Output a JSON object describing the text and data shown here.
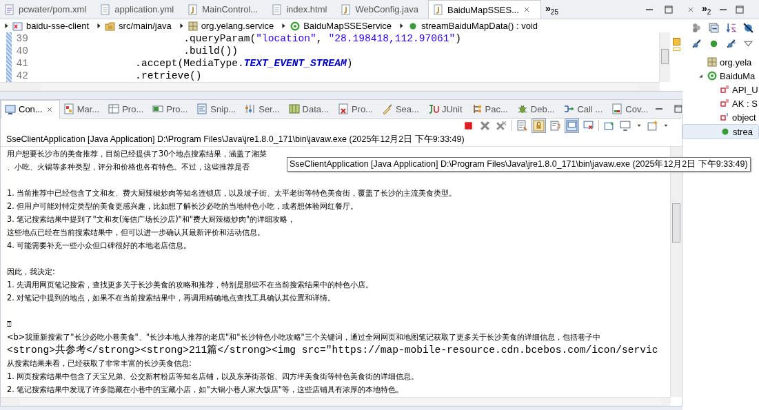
{
  "editor_tabs": [
    {
      "label": "pcwater/pom.xml",
      "selected": false
    },
    {
      "label": "application.yml",
      "selected": false
    },
    {
      "label": "MainControl...",
      "selected": false
    },
    {
      "label": "index.html",
      "selected": false
    },
    {
      "label": "WebConfig.java",
      "selected": false
    },
    {
      "label": "BaiduMapSSES...",
      "selected": true
    }
  ],
  "editor_overflow": {
    "glyph": "»",
    "count": "25"
  },
  "breadcrumb": [
    {
      "label": "baidu-sse-client"
    },
    {
      "label": "src/main/java"
    },
    {
      "label": "org.yelang.service"
    },
    {
      "label": "BaiduMapSSEService"
    },
    {
      "label": "streamBaiduMapData() : void"
    }
  ],
  "code_lines": [
    {
      "number": "39",
      "segments": [
        {
          "text": "                        .queryParam(",
          "kind": "plain"
        },
        {
          "text": "\"location\"",
          "kind": "string"
        },
        {
          "text": ", ",
          "kind": "plain"
        },
        {
          "text": "\"28.198418,112.97061\"",
          "kind": "string"
        },
        {
          "text": ")",
          "kind": "plain"
        }
      ]
    },
    {
      "number": "40",
      "segments": [
        {
          "text": "                        .build())",
          "kind": "plain"
        }
      ]
    },
    {
      "number": "41",
      "segments": [
        {
          "text": "                .accept(MediaType.",
          "kind": "plain"
        },
        {
          "text": "TEXT_EVENT_STREAM",
          "kind": "constant"
        },
        {
          "text": ")",
          "kind": "plain"
        }
      ]
    },
    {
      "number": "42",
      "segments": [
        {
          "text": "                .retrieve()",
          "kind": "plain"
        }
      ]
    }
  ],
  "console_tabs": [
    {
      "label": "Con...",
      "selected": true
    },
    {
      "label": "Mar...",
      "selected": false
    },
    {
      "label": "Pro...",
      "selected": false
    },
    {
      "label": "Pro...",
      "selected": false
    },
    {
      "label": "Snip...",
      "selected": false
    },
    {
      "label": "Ser...",
      "selected": false
    },
    {
      "label": "Data...",
      "selected": false
    },
    {
      "label": "Pro...",
      "selected": false
    },
    {
      "label": "Sea...",
      "selected": false
    },
    {
      "label": "JUnit",
      "selected": false
    },
    {
      "label": "Pac...",
      "selected": false
    },
    {
      "label": "Deb...",
      "selected": false
    },
    {
      "label": "Call ...",
      "selected": false
    },
    {
      "label": "Cov...",
      "selected": false
    }
  ],
  "console_title": "SseClientApplication [Java Application] D:\\Program Files\\Java\\jre1.8.0_171\\bin\\javaw.exe (2025年12月2日 下午9:33:49)",
  "console_lines": [
    {
      "kind": "text",
      "text": "用户想要长沙市的美食推荐，目前已经提供了30个地点搜索结果，涵盖了湘菜"
    },
    {
      "kind": "text",
      "text": "、小吃、火锅等多种类型，评分和价格也各有特色。不过，这些推荐是否"
    },
    {
      "kind": "blank"
    },
    {
      "kind": "text",
      "text": "1. 当前推荐中已经包含了文和友、费大厨辣椒炒肉等知名连锁店，以及坡子街、太平老街等特色美食街，覆盖了长沙的主流美食类型。"
    },
    {
      "kind": "text",
      "text": "2. 但用户可能对特定类型的美食更感兴趣，比如想了解长沙必吃的当地特色小吃，或者想体验网红餐厅。"
    },
    {
      "kind": "text",
      "text": "3. 笔记搜索结果中提到了\"文和友(海信广场长沙店)\"和\"费大厨辣椒炒肉\"的详细攻略，"
    },
    {
      "kind": "text",
      "text": "这些地点已经在当前搜索结果中，但可以进一步确认其最新评价和活动信息。"
    },
    {
      "kind": "text",
      "text": "4. 可能需要补充一些小众但口碑很好的本地老店信息。"
    },
    {
      "kind": "blank"
    },
    {
      "kind": "text",
      "text": "因此，我决定:"
    },
    {
      "kind": "text",
      "text": "1. 先调用网页笔记搜索，查找更多关于长沙美食的攻略和推荐，特别是那些不在当前搜索结果中的特色小店。"
    },
    {
      "kind": "text",
      "text": "2. 对笔记中提到的地点，如果不在当前搜索结果中，再调用精确地点查找工具确认其位置和详情。"
    },
    {
      "kind": "blank"
    },
    {
      "kind": "text",
      "text": "⍰"
    },
    {
      "kind": "text",
      "text": "<b>我重新搜索了\"长沙必吃小巷美食\"、\"长沙本地人推荐的老店\"和\"长沙特色小吃攻略\"三个关键词，通过全网网页和地图笔记获取了更多关于长沙美食的详细信息，包括巷子中"
    },
    {
      "kind": "mono",
      "text": "<strong>共参考</strong><strong>211篇</strong><img src=\"https://map-mobile-resource.cdn.bcebos.com/icon/servic"
    },
    {
      "kind": "text",
      "text": "从搜索结果来看，已经获取了非常丰富的长沙美食信息:"
    },
    {
      "kind": "text",
      "text": "1. 网页搜索结果中包含了天宝兄弟、公交新村粉店等知名店铺，以及东茅街茶馆、四方坪美食街等特色美食街的详细信息。"
    },
    {
      "kind": "text",
      "text": "2. 笔记搜索结果中发现了许多隐藏在小巷中的宝藏小店，如\"大锅小巷人家大饭店\"等，这些店铺具有浓厚的本地特色。"
    }
  ],
  "tooltip": "SseClientApplication [Java Application] D:\\Program Files\\Java\\jre1.8.0_171\\bin\\javaw.exe (2025年12月2日 下午9:33:49)",
  "outline_overflow": {
    "glyph": "»",
    "count": "2"
  },
  "outline_items": [
    {
      "label": "org.yela",
      "kind": "package",
      "selected": false
    },
    {
      "label": "BaiduMa",
      "kind": "class",
      "selected": false,
      "expanded": true,
      "children": [
        {
          "label": "API_U",
          "kind": "constant",
          "selected": false
        },
        {
          "label": "AK : S",
          "kind": "constant",
          "selected": false
        },
        {
          "label": "object",
          "kind": "field",
          "selected": false
        },
        {
          "label": "strea",
          "kind": "method",
          "selected": true
        }
      ]
    }
  ]
}
